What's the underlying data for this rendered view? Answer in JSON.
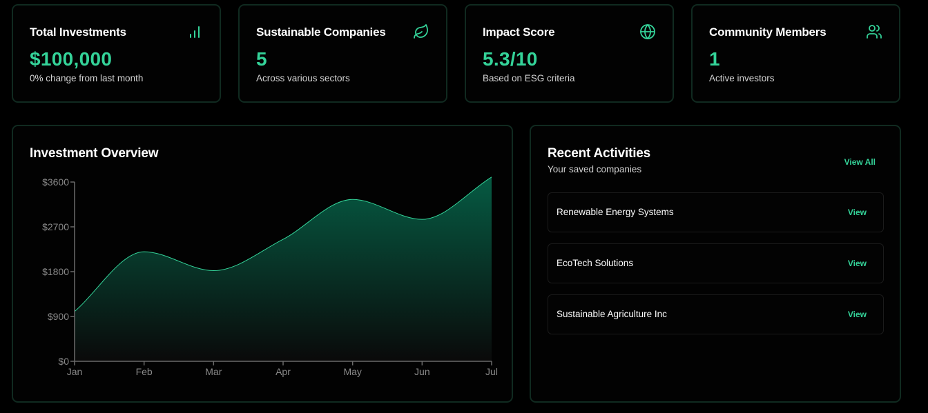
{
  "stats": [
    {
      "title": "Total Investments",
      "value": "$100,000",
      "sub": "0% change from last month",
      "icon": "bar-chart-icon"
    },
    {
      "title": "Sustainable Companies",
      "value": "5",
      "sub": "Across various sectors",
      "icon": "leaf-icon"
    },
    {
      "title": "Impact Score",
      "value": "5.3/10",
      "sub": "Based on ESG criteria",
      "icon": "globe-icon"
    },
    {
      "title": "Community Members",
      "value": "1",
      "sub": "Active investors",
      "icon": "users-icon"
    }
  ],
  "overview": {
    "title": "Investment Overview"
  },
  "chart_data": {
    "type": "area",
    "categories": [
      "Jan",
      "Feb",
      "Mar",
      "Apr",
      "May",
      "Jun",
      "Jul"
    ],
    "values": [
      1000,
      2200,
      1820,
      2450,
      3250,
      2850,
      3700
    ],
    "yticks": [
      "$0",
      "$900",
      "$1800",
      "$2700",
      "$3600"
    ],
    "ylim": [
      0,
      3600
    ],
    "grid": false,
    "color": "#34d399"
  },
  "activities": {
    "title": "Recent Activities",
    "subtitle": "Your saved companies",
    "view_all": "View All",
    "items": [
      {
        "name": "Renewable Energy Systems",
        "action": "View"
      },
      {
        "name": "EcoTech Solutions",
        "action": "View"
      },
      {
        "name": "Sustainable Agriculture Inc",
        "action": "View"
      }
    ]
  },
  "colors": {
    "accent": "#34d399",
    "border": "#102a20",
    "background": "#000000"
  }
}
